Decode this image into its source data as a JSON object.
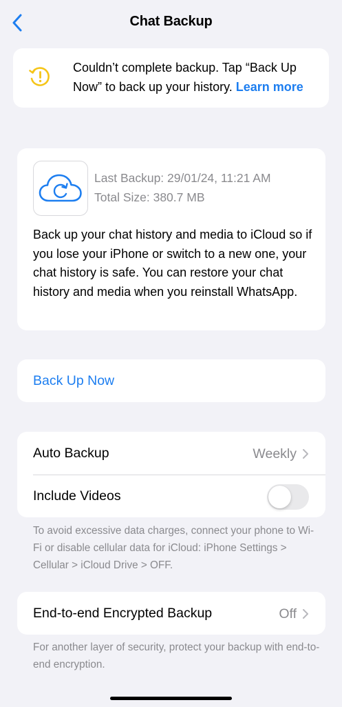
{
  "header": {
    "title": "Chat Backup",
    "back_icon": "chevron-left-icon"
  },
  "warning": {
    "icon": "clock-alert-icon",
    "message": "Couldn’t complete backup. Tap “Back Up Now” to back up your history. ",
    "link": "Learn more",
    "icon_color": "#f5c518"
  },
  "backup_info": {
    "icon": "icloud-sync-icon",
    "last_backup": "Last Backup: 29/01/24, 11:21 AM",
    "total_size": "Total Size: 380.7 MB",
    "description": "Back up your chat history and media to iCloud so if you lose your iPhone or switch to a new one, your chat history is safe. You can restore your chat history and media when you reinstall WhatsApp."
  },
  "actions": {
    "back_up_now": "Back Up Now"
  },
  "settings": {
    "auto_backup_label": "Auto Backup",
    "auto_backup_value": "Weekly",
    "include_videos_label": "Include Videos",
    "include_videos_on": false,
    "cellular_note": "To avoid excessive data charges, connect your phone to Wi-Fi or disable cellular data for iCloud: iPhone Settings > Cellular > iCloud Drive > OFF."
  },
  "e2e": {
    "label": "End-to-end Encrypted Backup",
    "value": "Off",
    "note": "For another layer of security, protect your backup with end-to-end encryption."
  },
  "colors": {
    "accent": "#1d7ef0",
    "background": "#f2f2f7",
    "secondary_text": "#8a8a8e"
  }
}
